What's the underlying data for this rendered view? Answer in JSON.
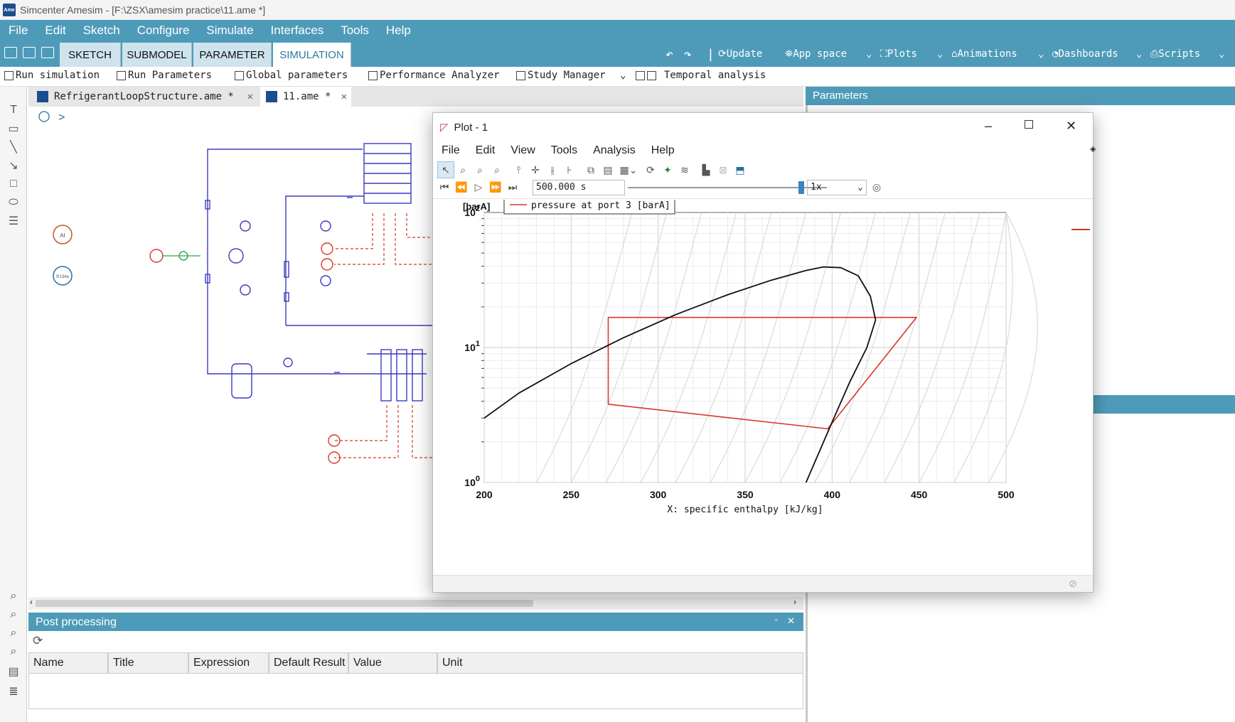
{
  "window": {
    "title": "Simcenter Amesim - [F:\\ZSX\\amesim practice\\11.ame *]",
    "logo": "Ame"
  },
  "menu": [
    "File",
    "Edit",
    "Sketch",
    "Configure",
    "Simulate",
    "Interfaces",
    "Tools",
    "Help"
  ],
  "ribbon": {
    "tabs": [
      "SKETCH",
      "SUBMODEL",
      "PARAMETER",
      "SIMULATION"
    ],
    "active_tab": "SIMULATION",
    "actions": [
      "Update",
      "App space",
      "Plots",
      "Animations",
      "Dashboards",
      "Scripts"
    ]
  },
  "commands": [
    "Run simulation",
    "Run Parameters",
    "Global parameters",
    "Performance Analyzer",
    "Study Manager",
    "Temporal analysis"
  ],
  "doc_tabs": [
    {
      "label": "RefrigerantLoopStructure.ame *"
    },
    {
      "label": "11.ame *"
    }
  ],
  "canvas": {
    "badges": [
      "AI",
      "R134a"
    ]
  },
  "parameters_panel": {
    "title": "Parameters"
  },
  "post_processing": {
    "title": "Post processing",
    "columns": [
      "Name",
      "Title",
      "Expression",
      "Default Result Se",
      "Value",
      "Unit"
    ]
  },
  "plot": {
    "title": "Plot - 1",
    "menu": [
      "File",
      "Edit",
      "View",
      "Tools",
      "Analysis",
      "Help"
    ],
    "time_value": "500.000 s",
    "speed": "1x",
    "legend": "pressure at port 3 [barA]",
    "series_color": "#d9362b"
  },
  "chart_data": {
    "type": "line",
    "title": "",
    "xlabel": "X: specific enthalpy [kJ/kg]",
    "ylabel": "[barA]",
    "x_ticks": [
      "200",
      "250",
      "300",
      "350",
      "400",
      "450",
      "500"
    ],
    "y_ticks": [
      {
        "base": "10",
        "exp": "0"
      },
      {
        "base": "10",
        "exp": "1"
      },
      {
        "base": "10",
        "exp": "2"
      }
    ],
    "xlim": [
      200,
      500
    ],
    "ylim": [
      1,
      100
    ],
    "y_scale": "log",
    "grid": true,
    "series": [
      {
        "name": "pressure at port 3 [barA]",
        "color": "#d9362b",
        "x": [
          271.3,
          271.3,
          448.5,
          397.5,
          271.3
        ],
        "y": [
          3.8,
          16.7,
          16.7,
          2.5,
          3.8
        ]
      },
      {
        "color": "#111111",
        "x": [
          200,
          220,
          250,
          280,
          310,
          340,
          365,
          385,
          395,
          405,
          415,
          422,
          425,
          420,
          410,
          400,
          385
        ],
        "y": [
          3.0,
          4.6,
          7.6,
          11.8,
          17.5,
          24.6,
          31.5,
          37.2,
          39.5,
          39.0,
          34.0,
          24.0,
          16.0,
          10.0,
          5.5,
          2.8,
          1.0
        ]
      }
    ]
  }
}
